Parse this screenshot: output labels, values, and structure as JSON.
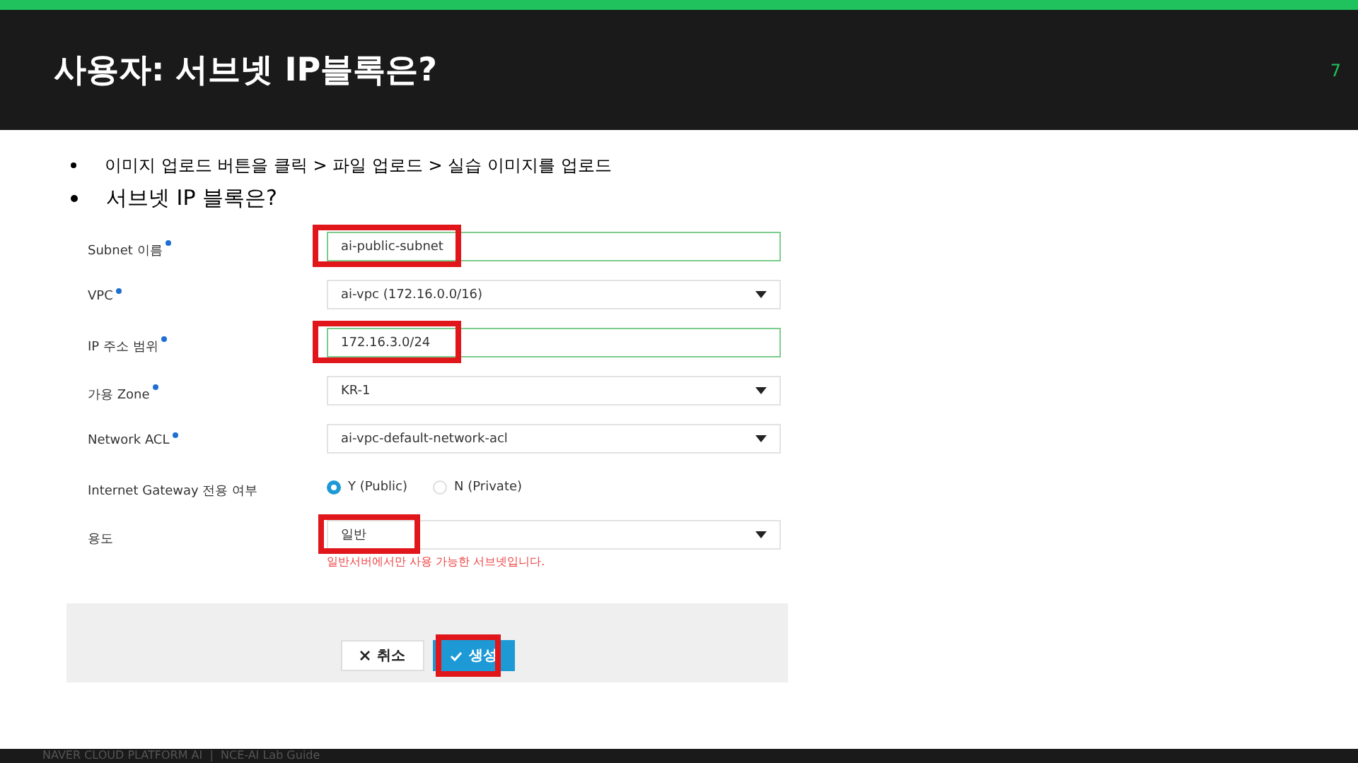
{
  "slide": {
    "title": "사용자: 서브넷 IP블록은?",
    "page_number": "7"
  },
  "bullets": [
    {
      "text": "이미지 업로드 버튼을 클릭 > 파일 업로드 > 실습 이미지를 업로드",
      "kind": "small"
    },
    {
      "text": "서브넷 IP 블록은?",
      "kind": "large"
    }
  ],
  "form": {
    "fields": [
      {
        "label": "Subnet 이름",
        "required": true,
        "kind": "input",
        "value": "ai-public-subnet",
        "highlighted": true
      },
      {
        "label": "VPC",
        "required": true,
        "kind": "select",
        "value": "ai-vpc (172.16.0.0/16)",
        "highlighted": false
      },
      {
        "label": "IP 주소 범위",
        "required": true,
        "kind": "input",
        "value": "172.16.3.0/24",
        "highlighted": true
      },
      {
        "label": "가용 Zone",
        "required": true,
        "kind": "select",
        "value": "KR-1",
        "highlighted": false
      },
      {
        "label": "Network ACL",
        "required": true,
        "kind": "select",
        "value": "ai-vpc-default-network-acl",
        "highlighted": false
      },
      {
        "label": "Internet Gateway 전용 여부",
        "required": false,
        "kind": "radio",
        "options": [
          {
            "label": "Y (Public)",
            "selected": true
          },
          {
            "label": "N (Private)",
            "selected": false
          }
        ]
      },
      {
        "label": "용도",
        "required": false,
        "kind": "select",
        "value": "일반",
        "highlighted": true,
        "hint": "일반서버에서만 사용 가능한 서브넷입니다."
      }
    ],
    "buttons": [
      {
        "label": "취소",
        "kind": "cancel",
        "highlighted": false
      },
      {
        "label": "생성",
        "kind": "create",
        "highlighted": true
      }
    ]
  },
  "footer": "NAVER CLOUD PLATFORM AI  |  NCE-AI Lab Guide"
}
